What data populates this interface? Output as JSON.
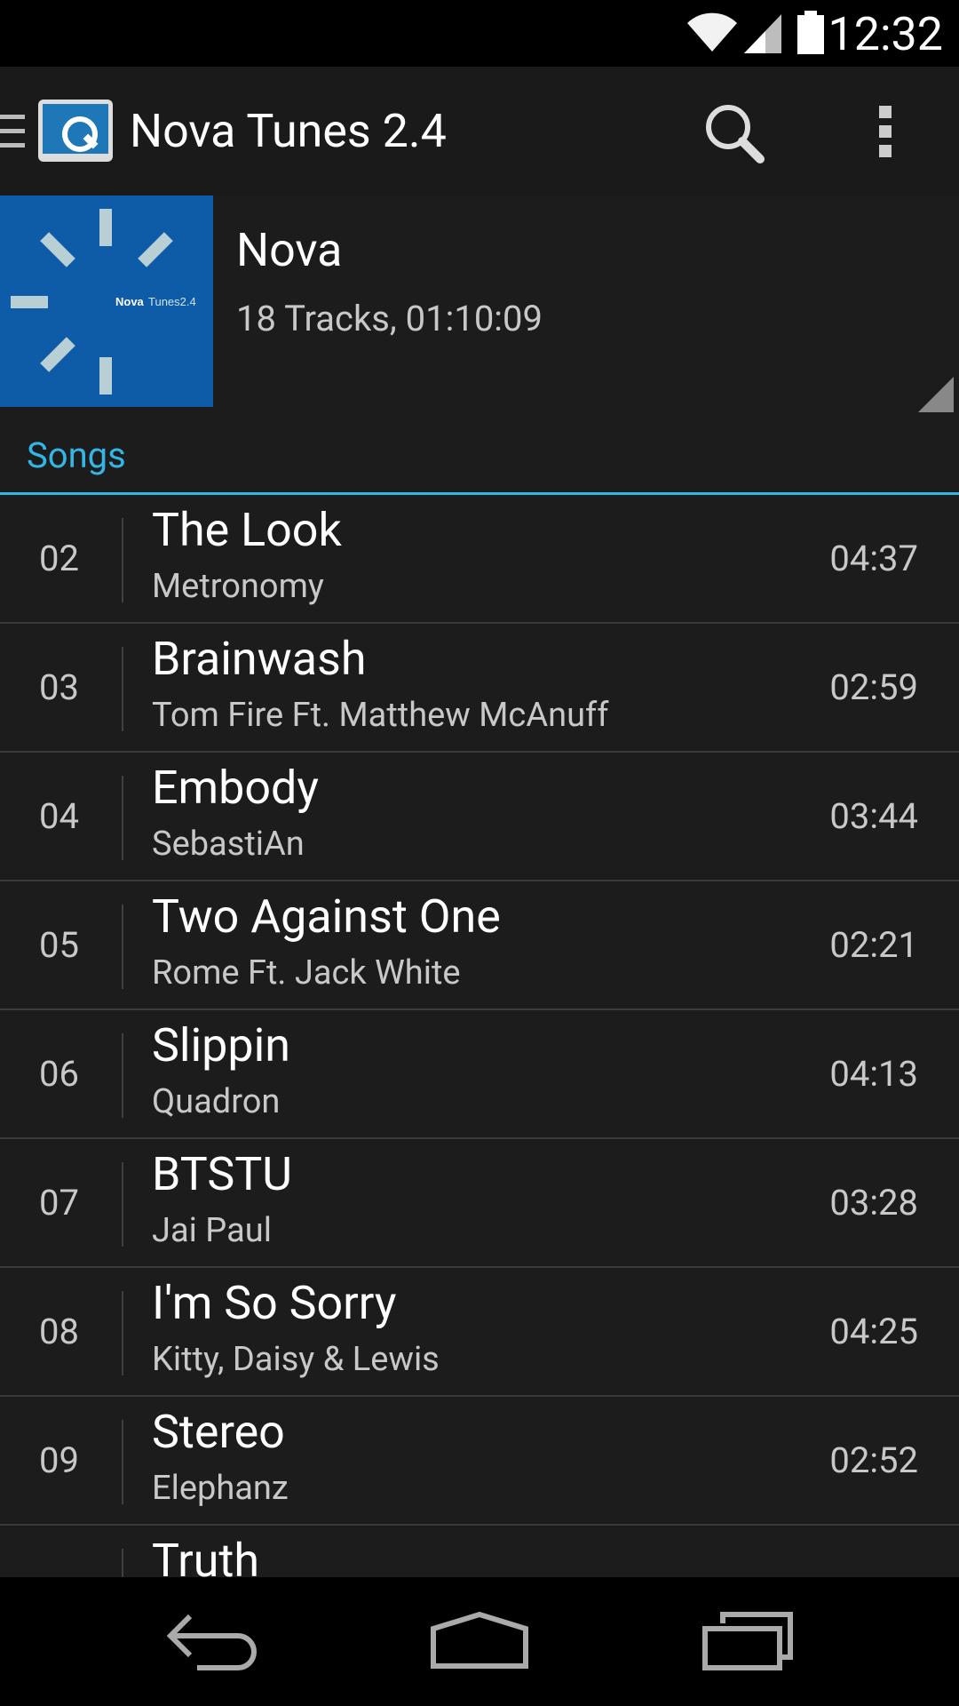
{
  "status_bar": {
    "time": "12:32",
    "icons": [
      "wifi-icon",
      "signal-icon",
      "battery-icon"
    ]
  },
  "app": {
    "title": "Nova Tunes 2.4",
    "icons": [
      "drawer-icon",
      "app-logo-icon",
      "search-icon",
      "overflow-menu-icon"
    ]
  },
  "album": {
    "title": "Nova",
    "meta": "18 Tracks, 01:10:09",
    "art_text_bold": "Nova",
    "art_text_light": "Tunes2.4",
    "art_color": "#0e5ca7"
  },
  "section": {
    "label": "Songs"
  },
  "tracks": [
    {
      "num": "02",
      "title": "The Look",
      "artist": "Metronomy",
      "duration": "04:37"
    },
    {
      "num": "03",
      "title": "Brainwash",
      "artist": "Tom Fire Ft. Matthew McAnuff",
      "duration": "02:59"
    },
    {
      "num": "04",
      "title": "Embody",
      "artist": "SebastiAn",
      "duration": "03:44"
    },
    {
      "num": "05",
      "title": "Two Against One",
      "artist": "Rome Ft. Jack White",
      "duration": "02:21"
    },
    {
      "num": "06",
      "title": "Slippin",
      "artist": "Quadron",
      "duration": "04:13"
    },
    {
      "num": "07",
      "title": "BTSTU",
      "artist": "Jai Paul",
      "duration": "03:28"
    },
    {
      "num": "08",
      "title": "I'm So Sorry",
      "artist": "Kitty, Daisy & Lewis",
      "duration": "04:25"
    },
    {
      "num": "09",
      "title": "Stereo",
      "artist": "Elephanz",
      "duration": "02:52"
    },
    {
      "num": "",
      "title": "Truth",
      "artist": "",
      "duration": ""
    }
  ],
  "nav": {
    "icons": [
      "back-icon",
      "home-icon",
      "recents-icon"
    ]
  },
  "colors": {
    "accent": "#33b5e5",
    "background": "#1c1c1c"
  }
}
